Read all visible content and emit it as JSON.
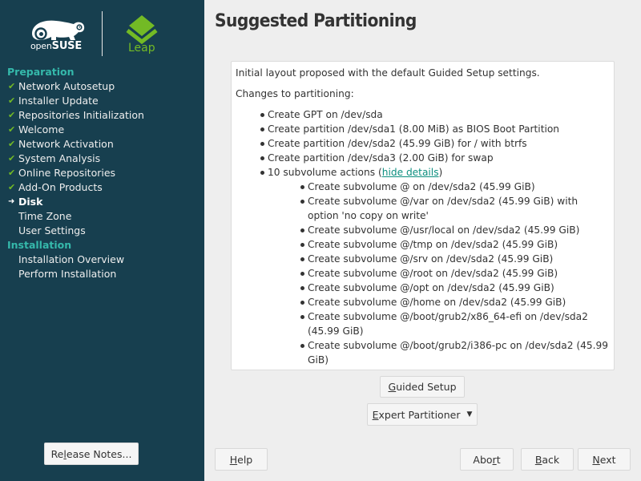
{
  "branding": {
    "distro_prefix": "open",
    "distro_name": "SUSE",
    "edition": "Leap",
    "accent_color": "#73ba25",
    "sidebar_bg": "#173f4f",
    "section_color": "#35b9ab"
  },
  "sidebar": {
    "sections": [
      {
        "title": "Preparation",
        "steps": [
          {
            "label": "Network Autosetup",
            "status": "done",
            "icon": "check-icon"
          },
          {
            "label": "Installer Update",
            "status": "done",
            "icon": "check-icon"
          },
          {
            "label": "Repositories Initialization",
            "status": "done",
            "icon": "check-icon"
          },
          {
            "label": "Welcome",
            "status": "done",
            "icon": "check-icon"
          },
          {
            "label": "Network Activation",
            "status": "done",
            "icon": "check-icon"
          },
          {
            "label": "System Analysis",
            "status": "done",
            "icon": "check-icon"
          },
          {
            "label": "Online Repositories",
            "status": "done",
            "icon": "check-icon"
          },
          {
            "label": "Add-On Products",
            "status": "done",
            "icon": "check-icon"
          },
          {
            "label": "Disk",
            "status": "current",
            "icon": "arrow-right-icon"
          },
          {
            "label": "Time Zone",
            "status": "pending",
            "icon": ""
          },
          {
            "label": "User Settings",
            "status": "pending",
            "icon": ""
          }
        ]
      },
      {
        "title": "Installation",
        "steps": [
          {
            "label": "Installation Overview",
            "status": "pending",
            "icon": ""
          },
          {
            "label": "Perform Installation",
            "status": "pending",
            "icon": ""
          }
        ]
      }
    ],
    "release_notes_button": {
      "pre": "Re",
      "accel": "l",
      "post": "ease Notes..."
    }
  },
  "main": {
    "title": "Suggested Partitioning",
    "summary": {
      "intro": "Initial layout proposed with the default Guided Setup settings.",
      "changes_heading": "Changes to partitioning:",
      "actions": [
        "Create GPT on /dev/sda",
        "Create partition /dev/sda1 (8.00 MiB) as BIOS Boot Partition",
        "Create partition /dev/sda2 (45.99 GiB) for / with btrfs",
        "Create partition /dev/sda3 (2.00 GiB) for swap"
      ],
      "subvolume_summary": {
        "pre": "10 subvolume actions (",
        "link": "hide details",
        "post": ")"
      },
      "subvolumes": [
        "Create subvolume @ on /dev/sda2 (45.99 GiB)",
        "Create subvolume @/var on /dev/sda2 (45.99 GiB) with option 'no copy on write'",
        "Create subvolume @/usr/local on /dev/sda2 (45.99 GiB)",
        "Create subvolume @/tmp on /dev/sda2 (45.99 GiB)",
        "Create subvolume @/srv on /dev/sda2 (45.99 GiB)",
        "Create subvolume @/root on /dev/sda2 (45.99 GiB)",
        "Create subvolume @/opt on /dev/sda2 (45.99 GiB)",
        "Create subvolume @/home on /dev/sda2 (45.99 GiB)",
        "Create subvolume @/boot/grub2/x86_64-efi on /dev/sda2 (45.99 GiB)",
        "Create subvolume @/boot/grub2/i386-pc on /dev/sda2 (45.99 GiB)"
      ]
    },
    "guided_setup_button": {
      "accel": "G",
      "post": "uided Setup"
    },
    "expert_partitioner_button": {
      "accel": "E",
      "post": "xpert Partitioner",
      "icon": "caret-down-icon"
    }
  },
  "footer": {
    "help": {
      "accel": "H",
      "post": "elp"
    },
    "abort": {
      "pre": "Abo",
      "accel": "r",
      "post": "t"
    },
    "back": {
      "accel": "B",
      "post": "ack"
    },
    "next": {
      "accel": "N",
      "post": "ext"
    }
  }
}
